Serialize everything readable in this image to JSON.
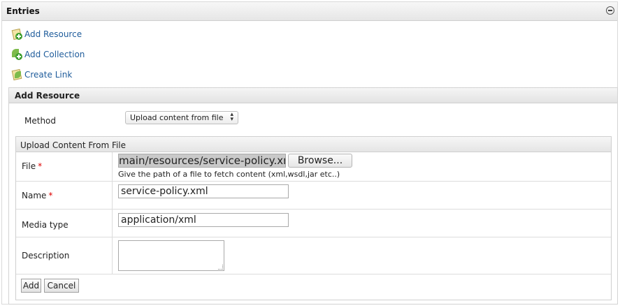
{
  "panel": {
    "title": "Entries"
  },
  "actions": [
    {
      "label": "Add Resource",
      "icon": "add-resource-icon"
    },
    {
      "label": "Add Collection",
      "icon": "add-collection-icon"
    },
    {
      "label": "Create Link",
      "icon": "create-link-icon"
    }
  ],
  "add_resource": {
    "title": "Add Resource",
    "method_label": "Method",
    "method_value": "Upload content from file",
    "upload": {
      "title": "Upload Content From File",
      "file": {
        "label": "File",
        "required": "*",
        "value": "main/resources/service-policy.xml",
        "browse_label": "Browse...",
        "hint": "Give the path of a file to fetch content (xml,wsdl,jar etc..)"
      },
      "name": {
        "label": "Name",
        "required": "*",
        "value": "service-policy.xml"
      },
      "media_type": {
        "label": "Media type",
        "value": "application/xml"
      },
      "description": {
        "label": "Description",
        "value": ""
      },
      "buttons": {
        "add": "Add",
        "cancel": "Cancel"
      }
    }
  },
  "colors": {
    "link": "#1f5c9b",
    "required": "#dd0000",
    "header_bg": "#e6e6e6"
  }
}
